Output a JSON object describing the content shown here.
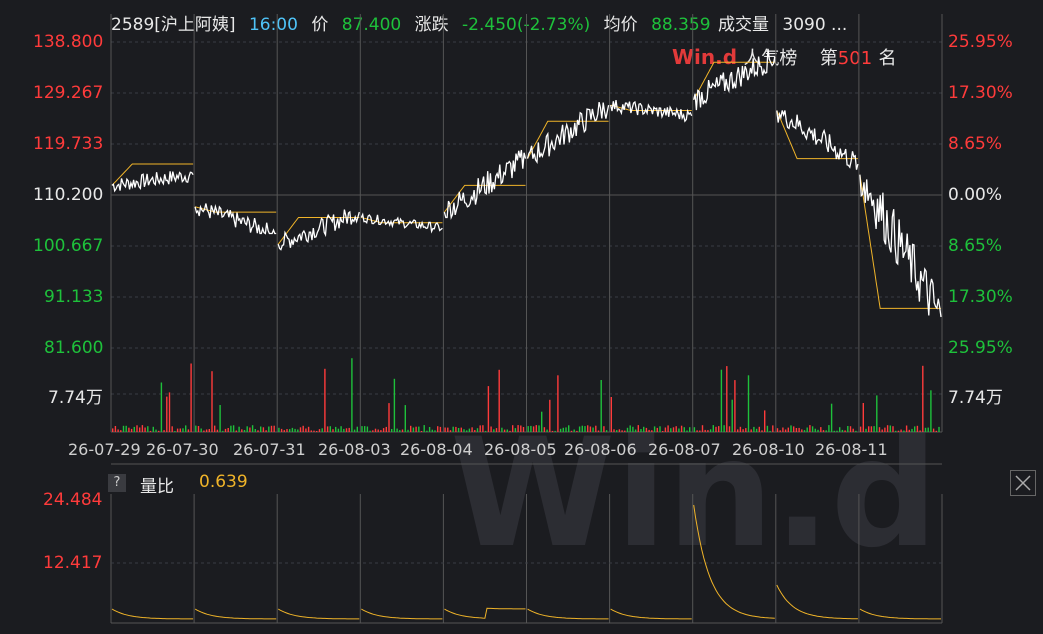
{
  "header": {
    "code_name": "2589[沪上阿姨]",
    "time": "16:00",
    "price_label": "价",
    "price_value": "87.400",
    "change_label": "涨跌",
    "change_value": "-2.450(-2.73%)",
    "avg_label": "均价",
    "avg_value": "88.359",
    "volume_label": "成交量",
    "volume_value": "3090 ..."
  },
  "popularity": {
    "brand": "Win.d",
    "label": "人气榜",
    "rank_prefix": "第",
    "rank_value": "501",
    "rank_suffix": "名"
  },
  "colors": {
    "up": "#ff3b3b",
    "down": "#1ec13b",
    "neutral": "#e8e8e8",
    "avg_line": "#f0b429",
    "price_line": "#ffffff",
    "grid": "#3a3d44",
    "header_cyan": "#4fc3f7"
  },
  "price_axis": {
    "left_labels": [
      "138.800",
      "129.267",
      "119.733",
      "110.200",
      "100.667",
      "91.133",
      "81.600"
    ],
    "right_labels": [
      "25.95%",
      "17.30%",
      "8.65%",
      "0.00%",
      "8.65%",
      "17.30%",
      "25.95%"
    ],
    "volume_label": "7.74万"
  },
  "date_axis": {
    "labels": [
      "26-07-29",
      "26-07-30",
      "26-07-31",
      "26-08-03",
      "26-08-04",
      "26-08-05",
      "26-08-06",
      "26-08-07",
      "26-08-10",
      "26-08-11"
    ]
  },
  "ratio_panel": {
    "help_icon": "?",
    "label": "量比",
    "value": "0.639",
    "axis_labels": [
      "24.484",
      "12.417"
    ],
    "close_icon": "close-icon"
  },
  "chart_data": {
    "type": "line",
    "title": "",
    "y_range": [
      81.6,
      138.8
    ],
    "prev_close": 110.2,
    "days": [
      "26-07-29",
      "26-07-30",
      "26-07-31",
      "26-08-03",
      "26-08-04",
      "26-08-05",
      "26-08-06",
      "26-08-07",
      "26-08-10",
      "26-08-11"
    ],
    "price_series": [
      {
        "day": "26-07-29",
        "open": 112,
        "high": 118,
        "low": 110,
        "close": 114,
        "avg": 116
      },
      {
        "day": "26-07-30",
        "open": 108,
        "high": 112,
        "low": 103,
        "close": 103,
        "avg": 107
      },
      {
        "day": "26-07-31",
        "open": 101,
        "high": 110,
        "low": 100,
        "close": 107,
        "avg": 106
      },
      {
        "day": "26-08-03",
        "open": 106,
        "high": 107,
        "low": 102,
        "close": 104,
        "avg": 105
      },
      {
        "day": "26-08-04",
        "open": 107,
        "high": 120,
        "low": 106,
        "close": 117,
        "avg": 112
      },
      {
        "day": "26-08-05",
        "open": 117,
        "high": 129,
        "low": 116,
        "close": 127,
        "avg": 124
      },
      {
        "day": "26-08-06",
        "open": 127,
        "high": 131,
        "low": 124,
        "close": 125,
        "avg": 126
      },
      {
        "day": "26-08-07",
        "open": 128,
        "high": 139,
        "low": 126,
        "close": 136,
        "avg": 135
      },
      {
        "day": "26-08-10",
        "open": 126,
        "high": 126,
        "low": 114,
        "close": 116,
        "avg": 117
      },
      {
        "day": "26-08-11",
        "open": 114,
        "high": 114,
        "low": 86,
        "close": 87.4,
        "avg": 89
      }
    ],
    "volume_max": 77400,
    "ratio_range": [
      0,
      24.484
    ]
  }
}
